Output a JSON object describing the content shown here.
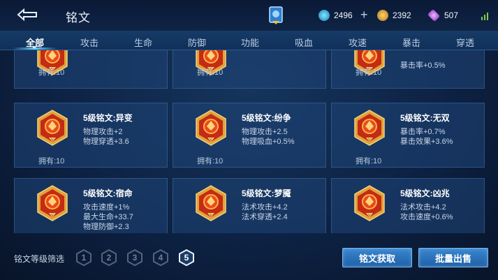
{
  "header": {
    "title": "铭文",
    "currency_1": "2496",
    "currency_2": "2392",
    "currency_3": "507"
  },
  "tabs": [
    "全部",
    "攻击",
    "生命",
    "防御",
    "功能",
    "吸血",
    "攻速",
    "暴击",
    "穿透"
  ],
  "active_tab": "全部",
  "top_row": [
    {
      "owned": "拥有:10",
      "visible_attr": ""
    },
    {
      "owned": "拥有:10",
      "visible_attr": ""
    },
    {
      "owned": "拥有:10",
      "visible_attr": "暴击率+0.5%"
    }
  ],
  "cards": [
    {
      "name": "5级铭文:异变",
      "attrs": [
        "物理攻击+2",
        "物理穿透+3.6"
      ],
      "owned": "拥有:10"
    },
    {
      "name": "5级铭文:纷争",
      "attrs": [
        "物理攻击+2.5",
        "物理吸血+0.5%"
      ],
      "owned": "拥有:10"
    },
    {
      "name": "5级铭文:无双",
      "attrs": [
        "暴击率+0.7%",
        "暴击效果+3.6%"
      ],
      "owned": "拥有:10"
    },
    {
      "name": "5级铭文:宿命",
      "attrs": [
        "攻击速度+1%",
        "最大生命+33.7",
        "物理防御+2.3"
      ],
      "owned": ""
    },
    {
      "name": "5级铭文:梦魇",
      "attrs": [
        "法术攻击+4.2",
        "法术穿透+2.4"
      ],
      "owned": ""
    },
    {
      "name": "5级铭文:凶兆",
      "attrs": [
        "法术攻击+4.2",
        "攻击速度+0.6%"
      ],
      "owned": ""
    }
  ],
  "filter": {
    "label": "铭文等级筛选",
    "levels": [
      "1",
      "2",
      "3",
      "4",
      "5"
    ],
    "selected": "5"
  },
  "buttons": {
    "acquire": "铭文获取",
    "bulk_sell": "批量出售"
  },
  "colors": {
    "accent": "#68d1ff",
    "emblem_red": "#c42b14",
    "emblem_gold": "#e0a23a"
  }
}
